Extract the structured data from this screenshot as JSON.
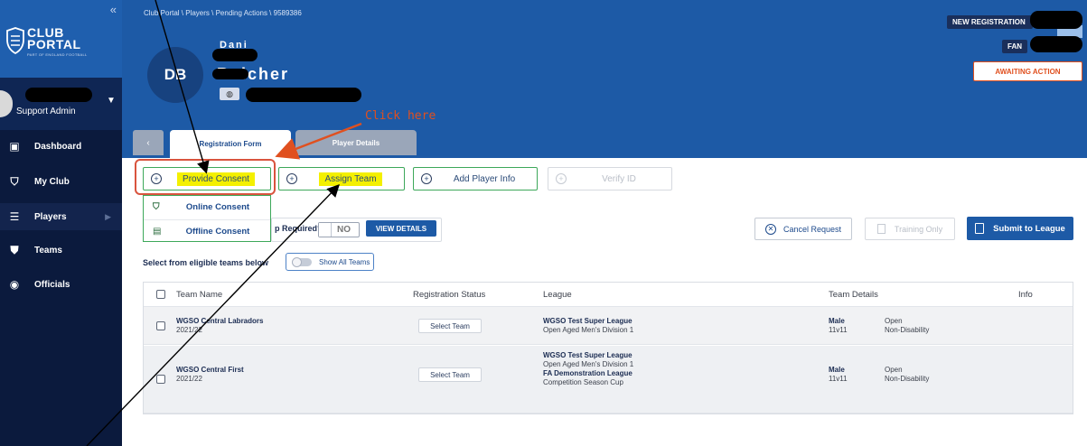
{
  "sidebar": {
    "collapse_glyph": "«",
    "logo_line1": "CLUB",
    "logo_line2": "PORTAL",
    "logo_sub": "PART OF ENGLAND FOOTBALL",
    "user_role": "Support Admin",
    "items": [
      {
        "label": "Dashboard",
        "icon": "dashboard-icon"
      },
      {
        "label": "My Club",
        "icon": "shield-icon"
      },
      {
        "label": "Players",
        "icon": "players-icon"
      },
      {
        "label": "Teams",
        "icon": "shirt-icon"
      },
      {
        "label": "Officials",
        "icon": "officials-icon"
      }
    ]
  },
  "header": {
    "breadcrumb": "Club Portal \\ Players \\ Pending Actions \\ 9589386",
    "avatar_initials": "DB",
    "name_fragment_top": "Dani",
    "name_fragment": "Belcher",
    "chip_new_registration": "NEW REGISTRATION",
    "chip_fan": "FAN",
    "chip_status": "AWAITING ACTION"
  },
  "tabs": [
    {
      "label": "Registration Form",
      "active": true
    },
    {
      "label": "Player Details",
      "active": false
    }
  ],
  "annotation": {
    "click_here": "Click here"
  },
  "actions": {
    "provide_consent": "Provide Consent",
    "assign_team": "Assign Team",
    "add_player_info": "Add Player Info",
    "verify_id": "Verify ID"
  },
  "consent_menu": {
    "online": "Online Consent",
    "offline": "Offline Consent"
  },
  "controls": {
    "required_label": "p Required?",
    "toggle_value": "NO",
    "view_details": "VIEW DETAILS",
    "cancel_request": "Cancel Request",
    "training_only": "Training Only",
    "submit_to_league": "Submit to League",
    "eligible_label": "Select from eligible teams below",
    "show_all_teams": "Show All Teams"
  },
  "table": {
    "headers": [
      "Team Name",
      "Registration Status",
      "League",
      "Team Details",
      "Info"
    ],
    "rows": [
      {
        "team": "WGSO Central Labradors",
        "season": "2021/22",
        "action": "Select Team",
        "league1": "WGSO Test Super League",
        "division1": "Open Aged Men's Division 1",
        "league2": "",
        "division2": "",
        "gender": "Male",
        "format": "11v11",
        "age": "Open",
        "disability": "Non-Disability"
      },
      {
        "team": "WGSO Central First",
        "season": "2021/22",
        "action": "Select Team",
        "league1": "WGSO Test Super League",
        "division1": "Open Aged Men's Division 1",
        "league2": "FA Demonstration League",
        "division2": "Competition Season Cup",
        "gender": "Male",
        "format": "11v11",
        "age": "Open",
        "disability": "Non-Disability"
      }
    ]
  },
  "colors": {
    "sidebar_bg": "#0b1a3d",
    "header_bg": "#1d5aa6",
    "accent_green": "#3da85a",
    "annotation_red": "#e0501f",
    "highlight_yellow": "#f4f000"
  }
}
